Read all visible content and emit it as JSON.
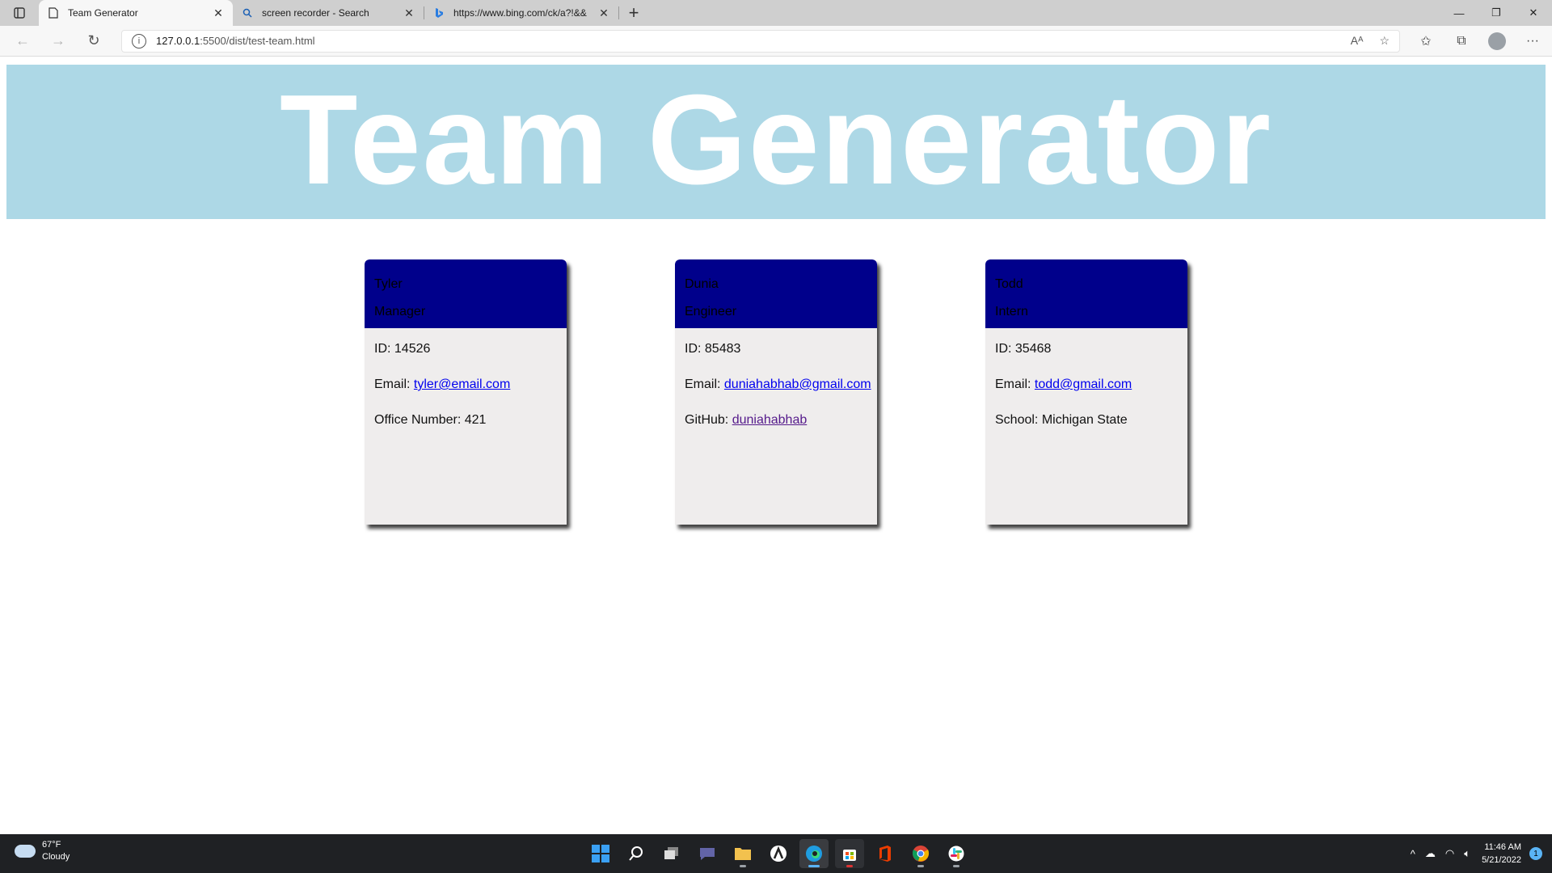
{
  "browser": {
    "tabs": [
      {
        "title": "Team Generator",
        "icon": "page-icon",
        "active": true
      },
      {
        "title": "screen recorder - Search",
        "icon": "search-icon",
        "active": false
      },
      {
        "title": "https://www.bing.com/ck/a?!&&",
        "icon": "bing-icon",
        "active": false
      }
    ],
    "url_host": "127.0.0.1",
    "url_path": ":5500/dist/test-team.html"
  },
  "page": {
    "title": "Team Generator",
    "cards": [
      {
        "name": "Tyler",
        "role": "Manager",
        "id_label": "ID:",
        "id": "14526",
        "email_label": "Email:",
        "email": "tyler@email.com",
        "extra_label": "Office Number:",
        "extra": "421"
      },
      {
        "name": "Dunia",
        "role": "Engineer",
        "id_label": "ID:",
        "id": "85483",
        "email_label": "Email:",
        "email": "duniahabhab@gmail.com",
        "extra_label": "GitHub:",
        "extra": "duniahabhab"
      },
      {
        "name": "Todd",
        "role": "Intern",
        "id_label": "ID:",
        "id": "35468",
        "email_label": "Email:",
        "email": "todd@gmail.com",
        "extra_label": "School:",
        "extra": "Michigan State"
      }
    ]
  },
  "taskbar": {
    "weather_temp": "67°F",
    "weather_desc": "Cloudy",
    "time": "11:46 AM",
    "date": "5/21/2022",
    "notifications": "1"
  },
  "colors": {
    "header_bg": "#add8e6",
    "card_head": "#00008b",
    "card_body": "#efeded"
  }
}
